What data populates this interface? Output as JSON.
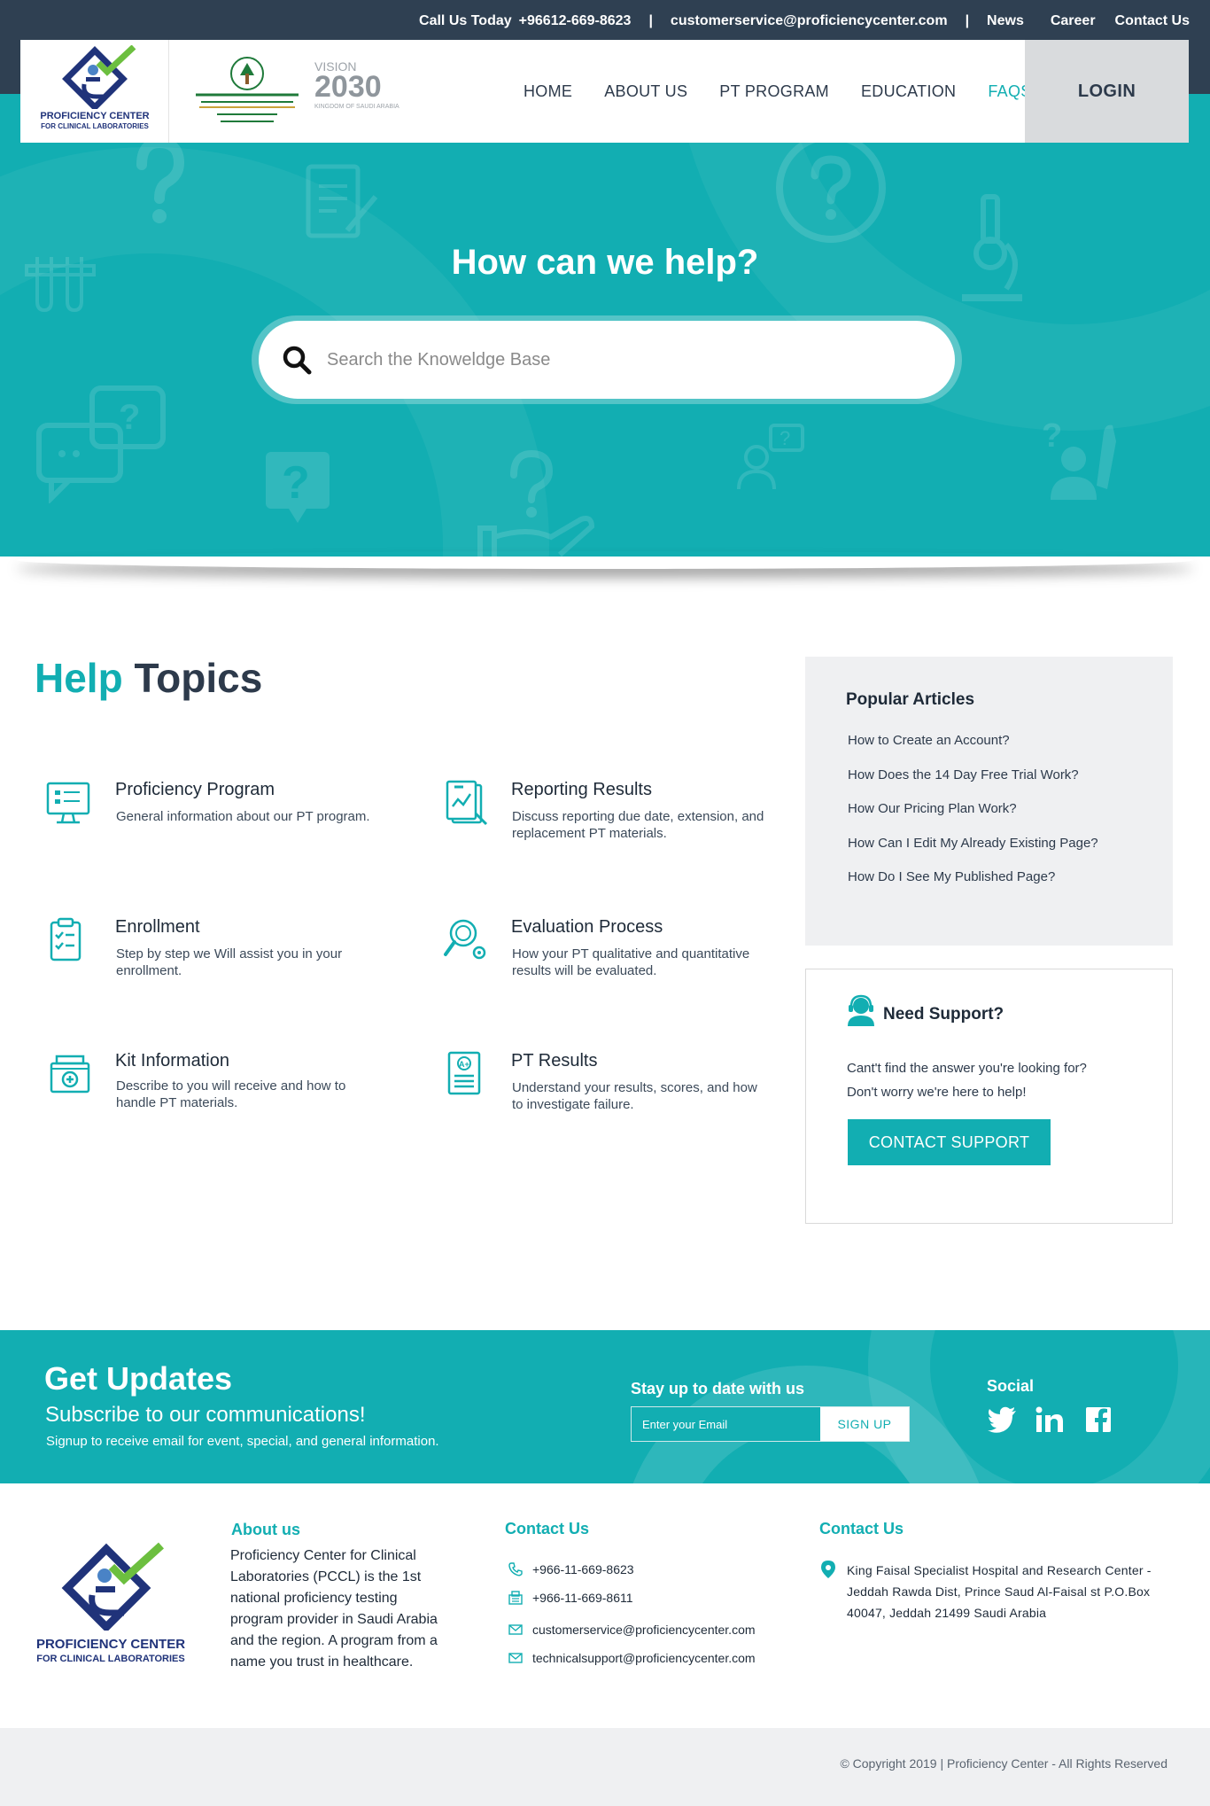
{
  "topbar": {
    "call_label": "Call Us Today",
    "phone": "+96612-669-8623",
    "separator": "|",
    "email": "customerservice@proficiencycenter.com",
    "links": [
      "News",
      "Career",
      "Contact Us"
    ]
  },
  "brand": {
    "name_line1": "PROFICIENCY CENTER",
    "name_line2": "FOR CLINICAL LABORATORIES",
    "vision_word": "VISION",
    "vision_year": "2030",
    "vision_sub": "KINGDOM OF SAUDI ARABIA"
  },
  "nav": {
    "items": [
      "HOME",
      "ABOUT US",
      "PT PROGRAM",
      "EDUCATION",
      "FAQS"
    ],
    "active_index": 4,
    "login": "LOGIN"
  },
  "hero": {
    "title": "How can we help?",
    "search_placeholder": "Search the Knoweldge Base"
  },
  "help": {
    "title_highlight": "Help",
    "title_rest": "Topics",
    "topics": [
      {
        "icon": "monitor-icon",
        "title": "Proficiency Program",
        "desc": "General information about our PT program."
      },
      {
        "icon": "report-icon",
        "title": "Reporting Results",
        "desc": "Discuss reporting due date, extension, and replacement PT materials."
      },
      {
        "icon": "clipboard-check-icon",
        "title": "Enrollment",
        "desc": "Step by step we Will assist you in your enrollment."
      },
      {
        "icon": "magnifier-gear-icon",
        "title": "Evaluation Process",
        "desc": "How your PT qualitative and quantitative results will be evaluated."
      },
      {
        "icon": "kit-box-icon",
        "title": "Kit Information",
        "desc": "Describe to you will receive and how to handle PT materials."
      },
      {
        "icon": "grade-document-icon",
        "title": "PT Results",
        "desc": "Understand your results, scores, and how to investigate failure."
      }
    ]
  },
  "popular": {
    "title": "Popular Articles",
    "articles": [
      "How to Create an Account?",
      "How Does the 14 Day Free Trial Work?",
      "How Our Pricing Plan Work?",
      "How Can I Edit My Already Existing Page?",
      "How Do I See My Published Page?"
    ]
  },
  "support": {
    "title": "Need Support?",
    "text_line1": "Cant't find the answer you're looking for?",
    "text_line2": "Don't worry we're here to help!",
    "button": "CONTACT SUPPORT"
  },
  "updates": {
    "title": "Get Updates",
    "subtitle": "Subscribe to our communications!",
    "note": "Signup to receive email for event, special, and general information.",
    "stay_label": "Stay up to date with us",
    "email_placeholder": "Enter your Email",
    "signup": "SIGN UP",
    "social_label": "Social",
    "social_icons": [
      "twitter-icon",
      "linkedin-icon",
      "facebook-icon"
    ]
  },
  "footer": {
    "about_title": "About us",
    "about_text": "Proficiency Center for Clinical Laboratories (PCCL) is the 1st national proficiency testing program provider in Saudi Arabia and the region. A program from a name you trust in healthcare.",
    "contact_title": "Contact Us",
    "phone1": "+966-11-669-8623",
    "phone2": "+966-11-669-8611",
    "email1": "customerservice@proficiencycenter.com",
    "email2": "technicalsupport@proficiencycenter.com",
    "address_title": "Contact Us",
    "address": "King Faisal Specialist Hospital and Research Center - Jeddah Rawda Dist, Prince Saud Al-Faisal st  P.O.Box 40047, Jeddah 21499 Saudi Arabia"
  },
  "copyright": "© Copyright  2019  |  Proficiency Center - All Rights Reserved",
  "colors": {
    "accent": "#12aeb2",
    "dark": "#2f4052",
    "text": "#2d3a4b",
    "panel": "#eff0f2"
  }
}
